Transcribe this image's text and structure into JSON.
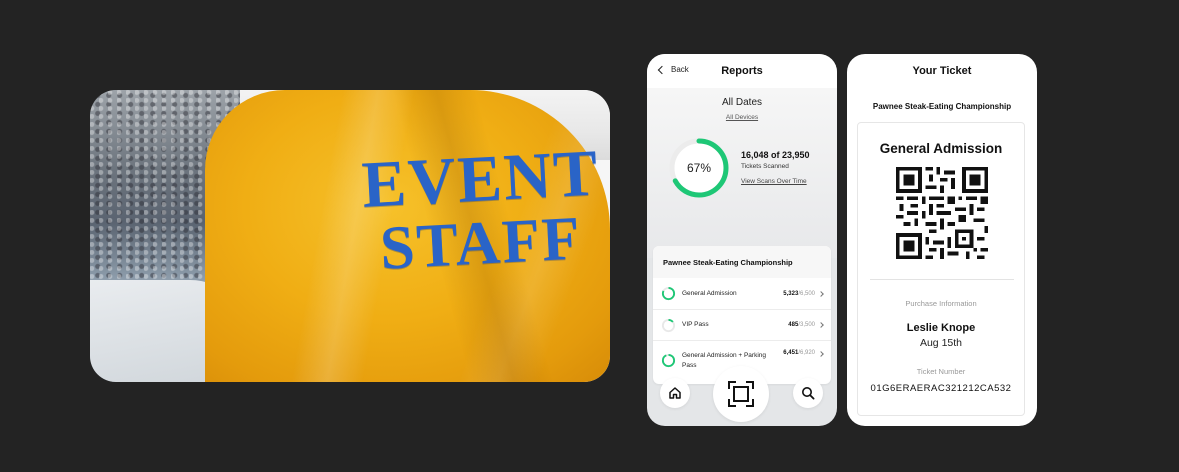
{
  "photo": {
    "jacket_line_1": "EVENT",
    "jacket_line_2": "STAFF",
    "jacket_color": "#f0ae14",
    "lettering_color": "#2a64c7"
  },
  "reports": {
    "back_label": "Back",
    "title": "Reports",
    "date_filter": "All Dates",
    "device_filter": "All Devices",
    "progress_percent_label": "67%",
    "progress_fraction": 0.67,
    "scan_count": "16,048 of 23,950",
    "scan_label": "Tickets Scanned",
    "scan_link": "View Scans Over Time",
    "accent_color": "#1ec776",
    "event_name": "Pawnee Steak-Eating Championship",
    "ticket_types": [
      {
        "name": "General Admission",
        "scanned": "5,323",
        "total": "/6,500",
        "fraction": 0.82
      },
      {
        "name": "VIP Pass",
        "scanned": "485",
        "total": "/3,500",
        "fraction": 0.14
      },
      {
        "name": "General Admission + Parking Pass",
        "scanned": "6,451",
        "total": "/6,920",
        "fraction": 0.93
      }
    ],
    "nav": {
      "home_icon": "home-icon",
      "scan_icon": "scan-frame-icon",
      "search_icon": "search-icon"
    }
  },
  "ticket": {
    "title": "Your Ticket",
    "event_name": "Pawnee Steak-Eating Championship",
    "admission_type": "General Admission",
    "purchase_label": "Purchase Information",
    "holder_name": "Leslie Knope",
    "date": "Aug 15th",
    "number_label": "Ticket Number",
    "ticket_number": "01G6ERAERAC321212CA532"
  }
}
